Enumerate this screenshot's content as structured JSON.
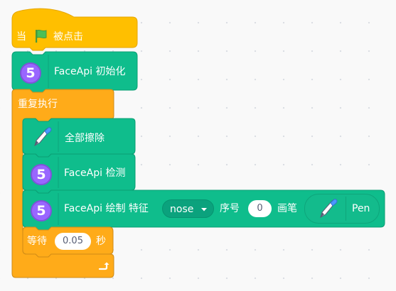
{
  "colors": {
    "control": "#ffab19",
    "control_dark": "#cf8b17",
    "extension": "#0fbd8c",
    "extension_dark": "#0b8e69",
    "face_icon": "#9966ff",
    "background": "#f9f9f9"
  },
  "blocks": {
    "hat": {
      "when_label": "当",
      "flag_icon": "green-flag-icon",
      "clicked_label": "被点击"
    },
    "init": {
      "icon": "face-api-5-icon",
      "icon_text": "5",
      "label": "FaceApi 初始化"
    },
    "repeat": {
      "label": "重复执行",
      "loop_icon": "loop-arrow-icon"
    },
    "clear": {
      "icon": "pen-icon",
      "label": "全部擦除"
    },
    "detect": {
      "icon": "face-api-5-icon",
      "icon_text": "5",
      "label": "FaceApi 检测"
    },
    "draw": {
      "icon": "face-api-5-icon",
      "icon_text": "5",
      "label": "FaceApi 绘制 特征",
      "feature_value": "nose",
      "index_label": "序号",
      "index_value": "0",
      "pen_label": "画笔",
      "pen_icon": "pen-icon",
      "pen_value": "Pen"
    },
    "wait": {
      "label_before": "等待",
      "value": "0.05",
      "label_after": "秒"
    }
  }
}
